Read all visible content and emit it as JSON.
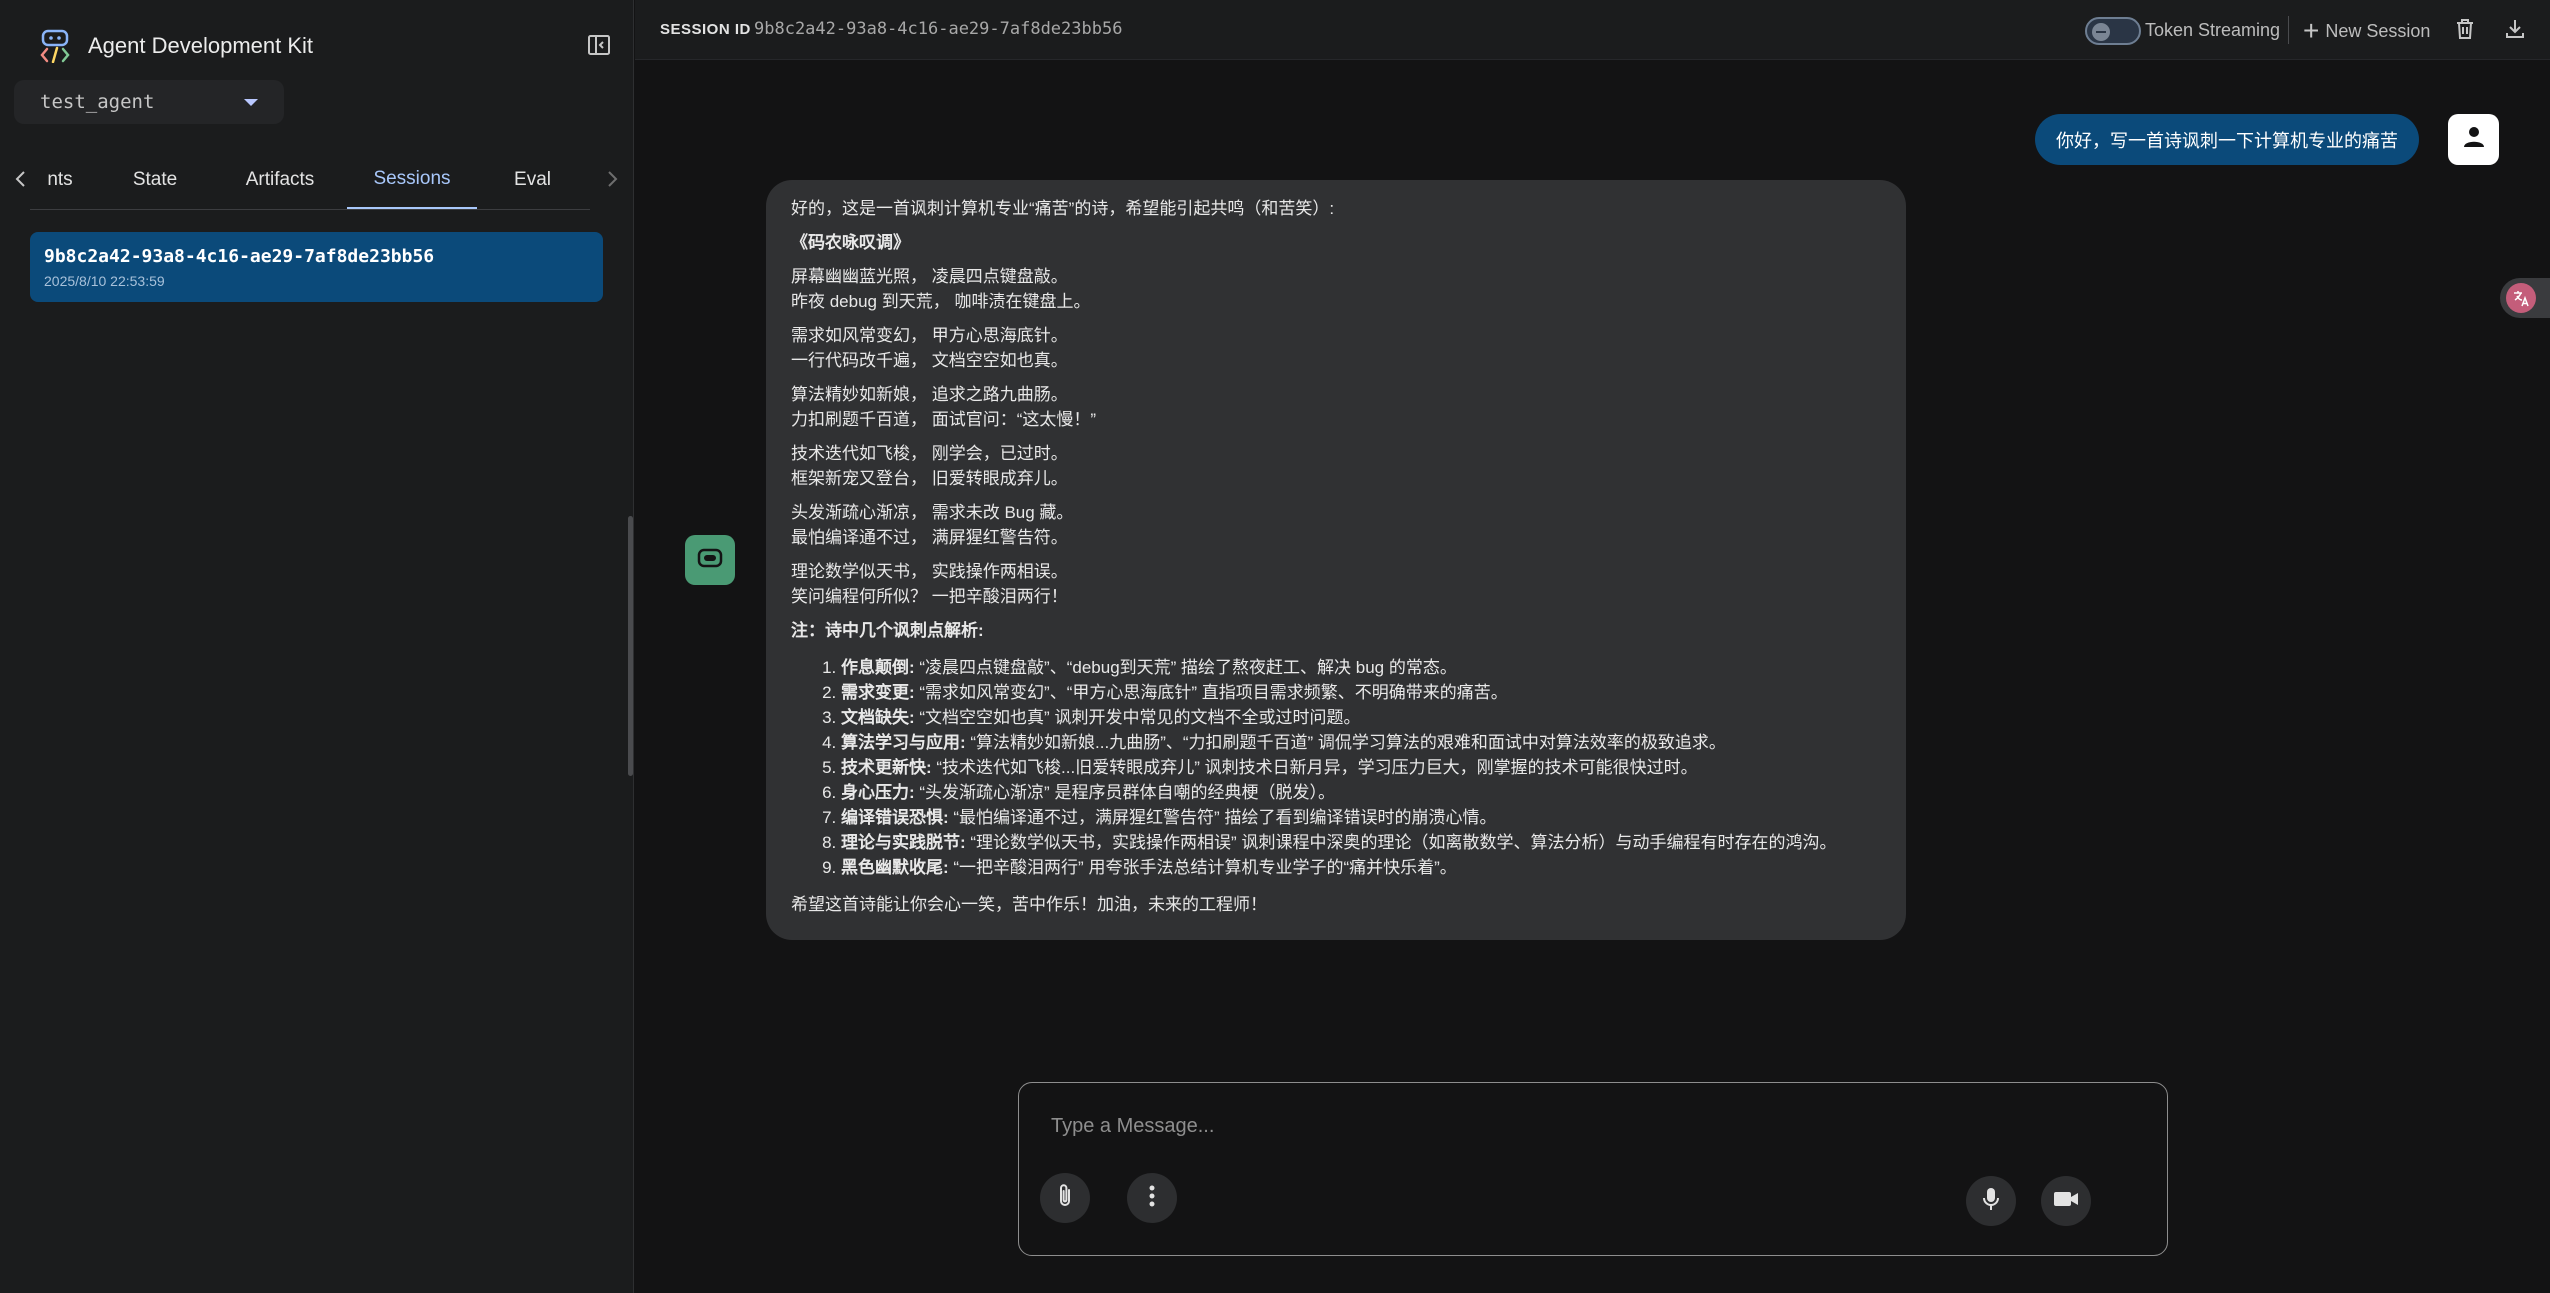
{
  "sidebar": {
    "title": "Agent Development Kit",
    "agent_select": {
      "value": "test_agent"
    },
    "tabs": [
      {
        "label": "nts"
      },
      {
        "label": "State"
      },
      {
        "label": "Artifacts"
      },
      {
        "label": "Sessions",
        "active": true
      },
      {
        "label": "Eval"
      }
    ],
    "sessions": [
      {
        "id": "9b8c2a42-93a8-4c16-ae29-7af8de23bb56",
        "date": "2025/8/10 22:53:59"
      }
    ]
  },
  "topbar": {
    "session_label": "SESSION ID",
    "session_id": "9b8c2a42-93a8-4c16-ae29-7af8de23bb56",
    "token_streaming_label": "Token Streaming",
    "token_streaming_on": false,
    "new_session_label": "New Session"
  },
  "chat": {
    "user_message": "你好，写一首诗讽刺一下计算机专业的痛苦",
    "bot": {
      "intro": "好的，这是一首讽刺计算机专业“痛苦”的诗，希望能引起共鸣（和苦笑）:",
      "poem_title": "《码农咏叹调》",
      "stanzas": [
        [
          "屏幕幽幽蓝光照， 凌晨四点键盘敲。",
          "昨夜 debug 到天荒， 咖啡渍在键盘上。"
        ],
        [
          "需求如风常变幻， 甲方心思海底针。",
          "一行代码改千遍， 文档空空如也真。"
        ],
        [
          "算法精妙如新娘， 追求之路九曲肠。",
          "力扣刷题千百道， 面试官问：“这太慢！”"
        ],
        [
          "技术迭代如飞梭， 刚学会，已过时。",
          "框架新宠又登台， 旧爱转眼成弃儿。"
        ],
        [
          "头发渐疏心渐凉， 需求未改 Bug 藏。",
          "最怕编译通不过， 满屏猩红警告符。"
        ],
        [
          "理论数学似天书， 实践操作两相误。",
          "笑问编程何所似？ 一把辛酸泪两行！"
        ]
      ],
      "notes_heading": "注：诗中几个讽刺点解析:",
      "notes": [
        {
          "term": "作息颠倒:",
          "text": " “凌晨四点键盘敲”、“debug到天荒” 描绘了熬夜赶工、解决 bug 的常态。"
        },
        {
          "term": "需求变更:",
          "text": " “需求如风常变幻”、“甲方心思海底针” 直指项目需求频繁、不明确带来的痛苦。"
        },
        {
          "term": "文档缺失:",
          "text": " “文档空空如也真” 讽刺开发中常见的文档不全或过时问题。"
        },
        {
          "term": "算法学习与应用:",
          "text": " “算法精妙如新娘...九曲肠”、“力扣刷题千百道” 调侃学习算法的艰难和面试中对算法效率的极致追求。"
        },
        {
          "term": "技术更新快:",
          "text": " “技术迭代如飞梭...旧爱转眼成弃儿” 讽刺技术日新月异，学习压力巨大，刚掌握的技术可能很快过时。"
        },
        {
          "term": "身心压力:",
          "text": " “头发渐疏心渐凉” 是程序员群体自嘲的经典梗（脱发）。"
        },
        {
          "term": "编译错误恐惧:",
          "text": " “最怕编译通不过，满屏猩红警告符” 描绘了看到编译错误时的崩溃心情。"
        },
        {
          "term": "理论与实践脱节:",
          "text": " “理论数学似天书，实践操作两相误” 讽刺课程中深奥的理论（如离散数学、算法分析）与动手编程有时存在的鸿沟。"
        },
        {
          "term": "黑色幽默收尾:",
          "text": " “一把辛酸泪两行” 用夸张手法总结计算机专业学子的“痛并快乐着”。"
        }
      ],
      "closing": "希望这首诗能让你会心一笑，苦中作乐！加油，未来的工程师！"
    }
  },
  "composer": {
    "placeholder": "Type a Message..."
  },
  "colors": {
    "accent": "#a8c7fa",
    "selected_bg": "#0b4a7a",
    "bot_avatar": "#4a9a74"
  },
  "icons": [
    "adk-logo-icon",
    "sidebar-collapse-icon",
    "chevron-left-icon",
    "chevron-right-icon",
    "plus-icon",
    "trash-icon",
    "download-icon",
    "person-icon",
    "bot-icon",
    "translate-icon",
    "attach-icon",
    "more-vert-icon",
    "mic-icon",
    "videocam-icon"
  ]
}
